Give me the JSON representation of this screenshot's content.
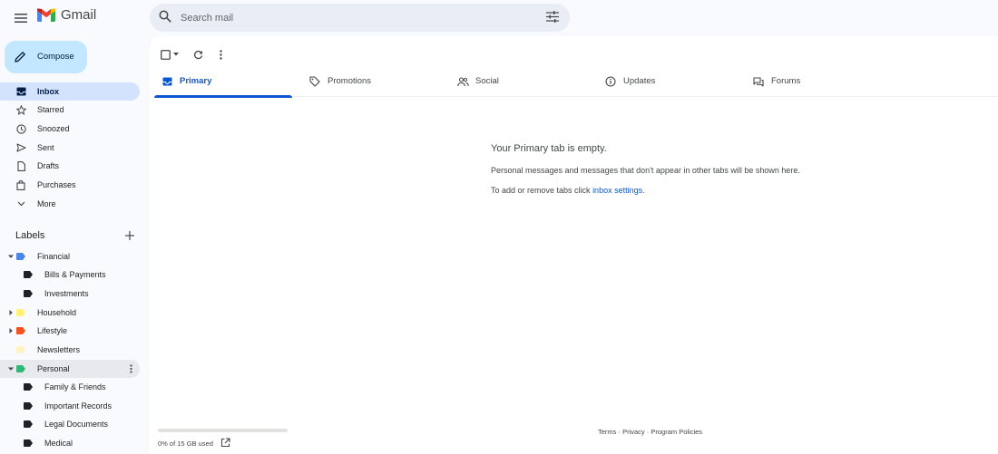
{
  "header": {
    "app_name": "Gmail",
    "search_placeholder": "Search mail"
  },
  "compose_label": "Compose",
  "nav": [
    {
      "label": "Inbox",
      "icon": "inbox-icon",
      "active": true
    },
    {
      "label": "Starred",
      "icon": "star-icon"
    },
    {
      "label": "Snoozed",
      "icon": "clock-icon"
    },
    {
      "label": "Sent",
      "icon": "send-icon"
    },
    {
      "label": "Drafts",
      "icon": "draft-icon"
    },
    {
      "label": "Purchases",
      "icon": "shopping-bag-icon"
    },
    {
      "label": "More",
      "icon": "chevron-down-icon"
    }
  ],
  "labels": {
    "heading": "Labels",
    "items": [
      {
        "label": "Financial",
        "color": "#4a86e8",
        "expanded": true
      },
      {
        "label": "Bills & Payments",
        "color": "#202124",
        "nested": true
      },
      {
        "label": "Investments",
        "color": "#202124",
        "nested": true
      },
      {
        "label": "Household",
        "color": "#fff176",
        "collapsed": true
      },
      {
        "label": "Lifestyle",
        "color": "#f4511e",
        "collapsed": true
      },
      {
        "label": "Newsletters",
        "color": "#fff3c4"
      },
      {
        "label": "Personal",
        "color": "#33b679",
        "expanded": true,
        "hover": true
      },
      {
        "label": "Family & Friends",
        "color": "#202124",
        "nested": true
      },
      {
        "label": "Important Records",
        "color": "#202124",
        "nested": true
      },
      {
        "label": "Legal Documents",
        "color": "#202124",
        "nested": true
      },
      {
        "label": "Medical",
        "color": "#202124",
        "nested": true
      }
    ]
  },
  "tabs": [
    {
      "label": "Primary",
      "icon": "inbox-tab-icon",
      "active": true
    },
    {
      "label": "Promotions",
      "icon": "tag-icon"
    },
    {
      "label": "Social",
      "icon": "people-icon"
    },
    {
      "label": "Updates",
      "icon": "info-icon"
    },
    {
      "label": "Forums",
      "icon": "forum-icon"
    }
  ],
  "empty_state": {
    "title": "Your Primary tab is empty.",
    "description": "Personal messages and messages that don't appear in other tabs will be shown here.",
    "link_prefix": "To add or remove tabs click ",
    "link_text": "inbox settings",
    "link_suffix": "."
  },
  "storage": {
    "text": "0% of 15 GB used",
    "used_fraction": 0
  },
  "footer": {
    "terms": "Terms",
    "privacy": "Privacy",
    "policies": "Program Policies",
    "separator": " · "
  },
  "colors": {
    "accent": "#0b57d0",
    "compose_bg": "#c2e7ff",
    "active_nav_bg": "#d3e3fd"
  }
}
